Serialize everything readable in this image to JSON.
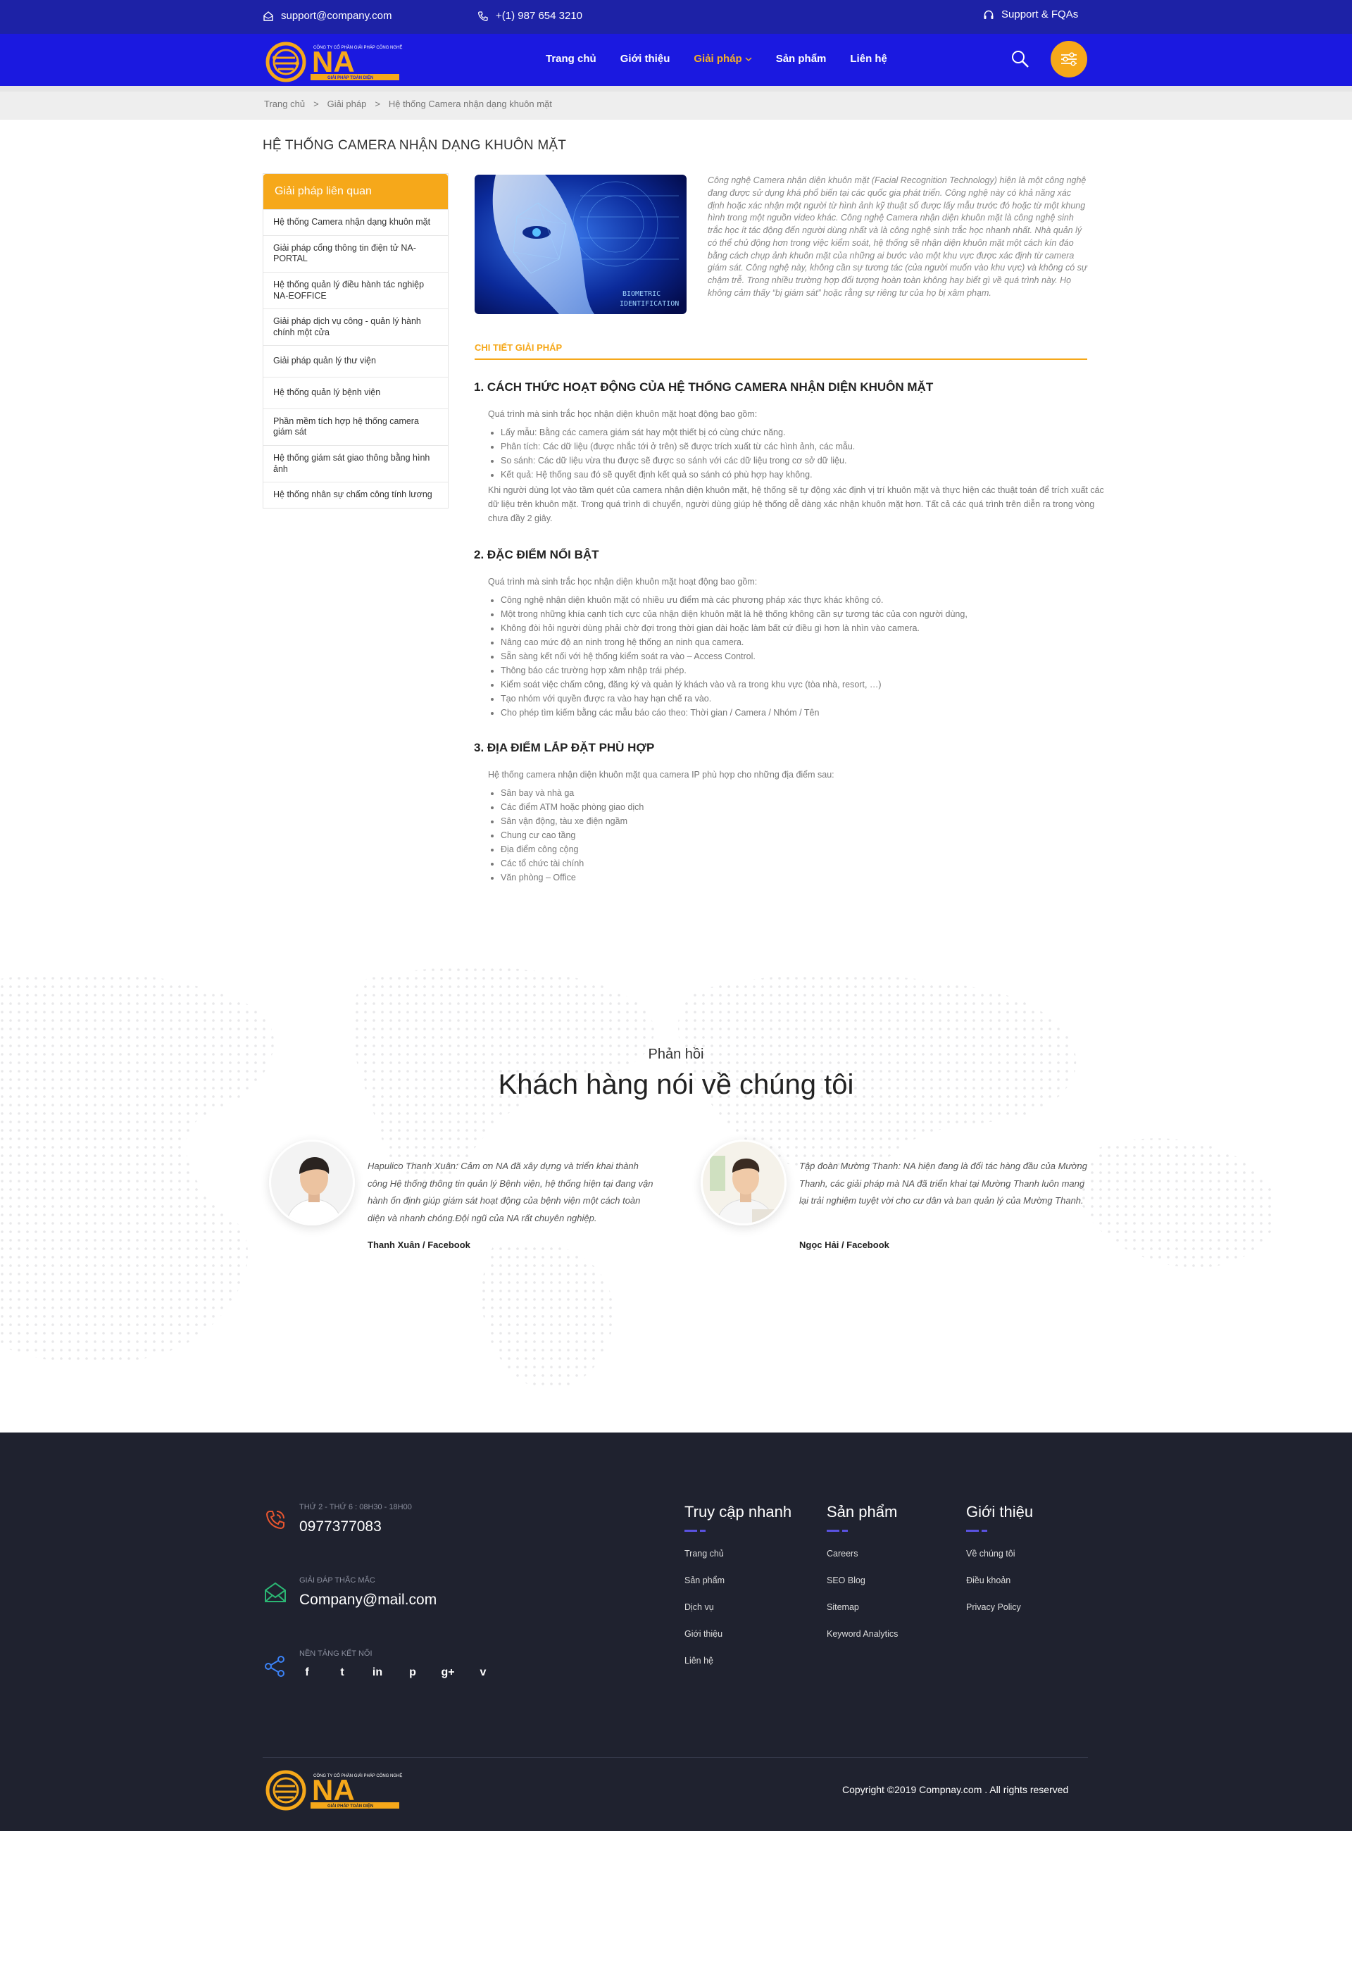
{
  "topbar": {
    "email": "support@company.com",
    "phone": "+(1) 987 654 3210",
    "support": "Support & FQAs"
  },
  "logo": {
    "company_line": "CÔNG TY CỔ PHẦN GIẢI PHÁP CÔNG NGHỆ",
    "initials": "NA",
    "tagline": "GIẢI PHÁP TOÀN DIỆN"
  },
  "nav": {
    "items": [
      "Trang chủ",
      "Giới thiệu",
      "Giải pháp",
      "Sản phẩm",
      "Liên hệ"
    ]
  },
  "breadcrumb": [
    "Trang chủ",
    ">",
    "Giải pháp",
    ">",
    "Hệ thống Camera nhận dạng khuôn mặt"
  ],
  "page_title": "HỆ THỐNG CAMERA NHẬN DẠNG KHUÔN MẶT",
  "sidebar": {
    "title": "Giải pháp liên quan",
    "items": [
      "Hệ thống Camera nhận dạng khuôn mặt",
      "Giải pháp cổng thông tin điện tử NA-PORTAL",
      "Hệ thống quản lý điều hành tác nghiệp NA-EOFFICE",
      "Giải pháp dịch vụ công - quản lý hành chính một cửa",
      "Giải pháp quản lý thư viện",
      "Hệ thống quản lý bệnh viện",
      "Phần mềm tích hợp hệ thống camera giám sát",
      "Hệ thống giám sát giao thông bằng hình ảnh",
      "Hệ thống nhân sự chấm công tính lương"
    ]
  },
  "hero": {
    "image_caption_1": "BIOMETRIC",
    "image_caption_2": "IDENTIFICATION"
  },
  "intro_text": "Công nghệ Camera nhận diện khuôn mặt (Facial Recognition Technology) hiện là một công nghệ đang được sử dụng khá phổ biến tại các quốc gia phát triển. Công nghệ này có khả năng xác định hoặc xác nhận một người từ hình ảnh kỹ thuật số được lấy mẫu trước đó hoặc từ một khung hình trong một nguồn video khác. Công nghệ Camera nhận diện khuôn mặt là công nghệ sinh trắc học ít tác động đến người dùng nhất và là công nghệ sinh trắc học nhanh nhất. Nhà quản lý có thể chủ động hơn trong việc kiểm soát, hệ thống sẽ nhận diện khuôn mặt một cách kín đáo bằng cách chụp ảnh khuôn mặt của những ai bước vào một khu vực được xác định từ camera giám sát. Công nghệ này, không cần sự tương tác (của người muốn vào khu vực) và không có sự chậm trễ. Trong nhiều trường hợp đối tượng hoàn toàn không hay biết gì về quá trình này. Họ không cảm thấy “bị giám sát” hoặc rằng sự riêng tư của họ bị xâm phạm.",
  "detail_heading": "CHI TIẾT GIẢI PHÁP",
  "sections": [
    {
      "title": "1. CÁCH THỨC HOẠT ĐỘNG CỦA HỆ THỐNG CAMERA NHẬN DIỆN KHUÔN MẶT",
      "lead": "Quá trình mà sinh trắc học nhận diện khuôn mặt hoạt động bao gồm:",
      "bullets": [
        "Lấy mẫu: Bằng các camera giám sát hay một thiết bị có cùng chức năng.",
        "Phân tích: Các dữ liệu (được nhắc tới ở trên) sẽ được trích xuất từ các hình ảnh, các mẫu.",
        "So sánh: Các dữ liệu vừa thu được sẽ được so sánh với các dữ liệu trong cơ sở dữ liệu.",
        "Kết quả: Hệ thống sau đó sẽ quyết định kết quả so sánh có phù hợp hay không."
      ],
      "tail": "Khi người dùng lọt vào tầm quét của camera nhận diện khuôn mặt, hệ thống sẽ tự động xác định vị trí khuôn mặt và thực hiện các thuật toán để trích xuất các dữ liệu trên khuôn mặt. Trong quá trình di chuyển, người dùng giúp hệ thống dễ dàng xác nhận khuôn mặt hơn. Tất cả các quá trình trên diễn ra trong vòng chưa đầy 2 giây."
    },
    {
      "title": "2. ĐẶC ĐIỂM NỔI BẬT",
      "lead": "Quá trình mà sinh trắc học nhận diện khuôn mặt hoạt động bao gồm:",
      "bullets": [
        "Công nghệ nhận diện khuôn mặt có nhiều ưu điểm mà các phương pháp xác thực khác không có.",
        "Một trong những khía cạnh tích cực của nhận diện khuôn mặt là hệ thống không cần sự tương tác của con người dùng,",
        "Không đòi hỏi người dùng phải chờ đợi trong thời gian dài hoặc làm bất cứ điều gì hơn là nhìn vào camera.",
        "Nâng cao mức độ an ninh trong hệ thống an ninh qua camera.",
        "Sẵn sàng kết nối với hệ thống kiểm soát ra vào – Access Control.",
        "Thông báo các trường hợp xâm nhập trái phép.",
        "Kiểm soát việc chấm công, đăng ký và quản lý khách vào và ra trong khu vực (tòa nhà, resort, …)",
        "Tạo nhóm với quyền được ra vào hay hạn chế ra vào.",
        "Cho phép tìm kiếm bằng các mẫu báo cáo theo: Thời gian / Camera / Nhóm / Tên"
      ],
      "tail": ""
    },
    {
      "title": "3. ĐỊA ĐIỂM LẮP ĐẶT PHÙ HỢP",
      "lead": "Hệ thống camera nhận diện khuôn mặt qua camera IP phù hợp cho những địa điểm sau:",
      "bullets": [
        "Sân bay và nhà ga",
        "Các điểm ATM hoặc phòng giao dịch",
        "Sân vận động, tàu xe điện ngầm",
        "Chung cư cao tầng",
        "Địa điểm công cộng",
        "Các tổ chức tài chính",
        "Văn phòng – Office"
      ],
      "tail": ""
    }
  ],
  "testimonials": {
    "subtitle": "Phản hồi",
    "title": "Khách hàng nói về chúng tôi",
    "items": [
      {
        "quote": "Hapulico Thanh Xuân: Cảm ơn NA đã xây dựng và triển khai thành công Hệ thống thông tin quản lý Bệnh viện, hệ thống hiện tại đang vận hành ổn định giúp giám sát hoạt động của bệnh viện một cách toàn diện và nhanh chóng.Đội ngũ của NA rất chuyên nghiệp.",
        "author": "Thanh Xuân / Facebook"
      },
      {
        "quote": "Tập đoàn Mường Thanh: NA hiện đang là đối tác hàng đầu của Mường Thanh, các giải pháp mà NA đã triển khai tại Mường Thanh luôn mang lại trải nghiệm tuyệt vời cho cư dân và ban quản lý của Mường Thanh.",
        "author": "Ngọc Hải / Facebook"
      }
    ]
  },
  "footer": {
    "phone_caption": "THỨ 2 - THỨ 6 : 08H30 - 18H00",
    "phone": "0977377083",
    "mail_caption": "GIẢI ĐÁP THẮC MẮC",
    "mail": "Company@mail.com",
    "social_caption": "NỀN TẢNG KẾT NỐI",
    "socials": [
      "f",
      "t",
      "in",
      "p",
      "g+",
      "v"
    ],
    "columns": [
      {
        "title": "Truy cập nhanh",
        "links": [
          "Trang chủ",
          "Sản phẩm",
          "Dịch vụ",
          "Giới thiệu",
          "Liên hệ"
        ]
      },
      {
        "title": "Sản phẩm",
        "links": [
          "Careers",
          "SEO Blog",
          "Sitemap",
          "Keyword Analytics"
        ]
      },
      {
        "title": "Giới thiệu",
        "links": [
          "Về chúng tôi",
          "Điều khoản",
          "Privacy Policy"
        ]
      }
    ],
    "copyright": "Copyright ©2019 Compnay.com . All rights reserved"
  },
  "colors": {
    "topbar": "#1d22a6",
    "header": "#1b19e0",
    "accent": "#f6a81a",
    "footer": "#1f222f"
  }
}
